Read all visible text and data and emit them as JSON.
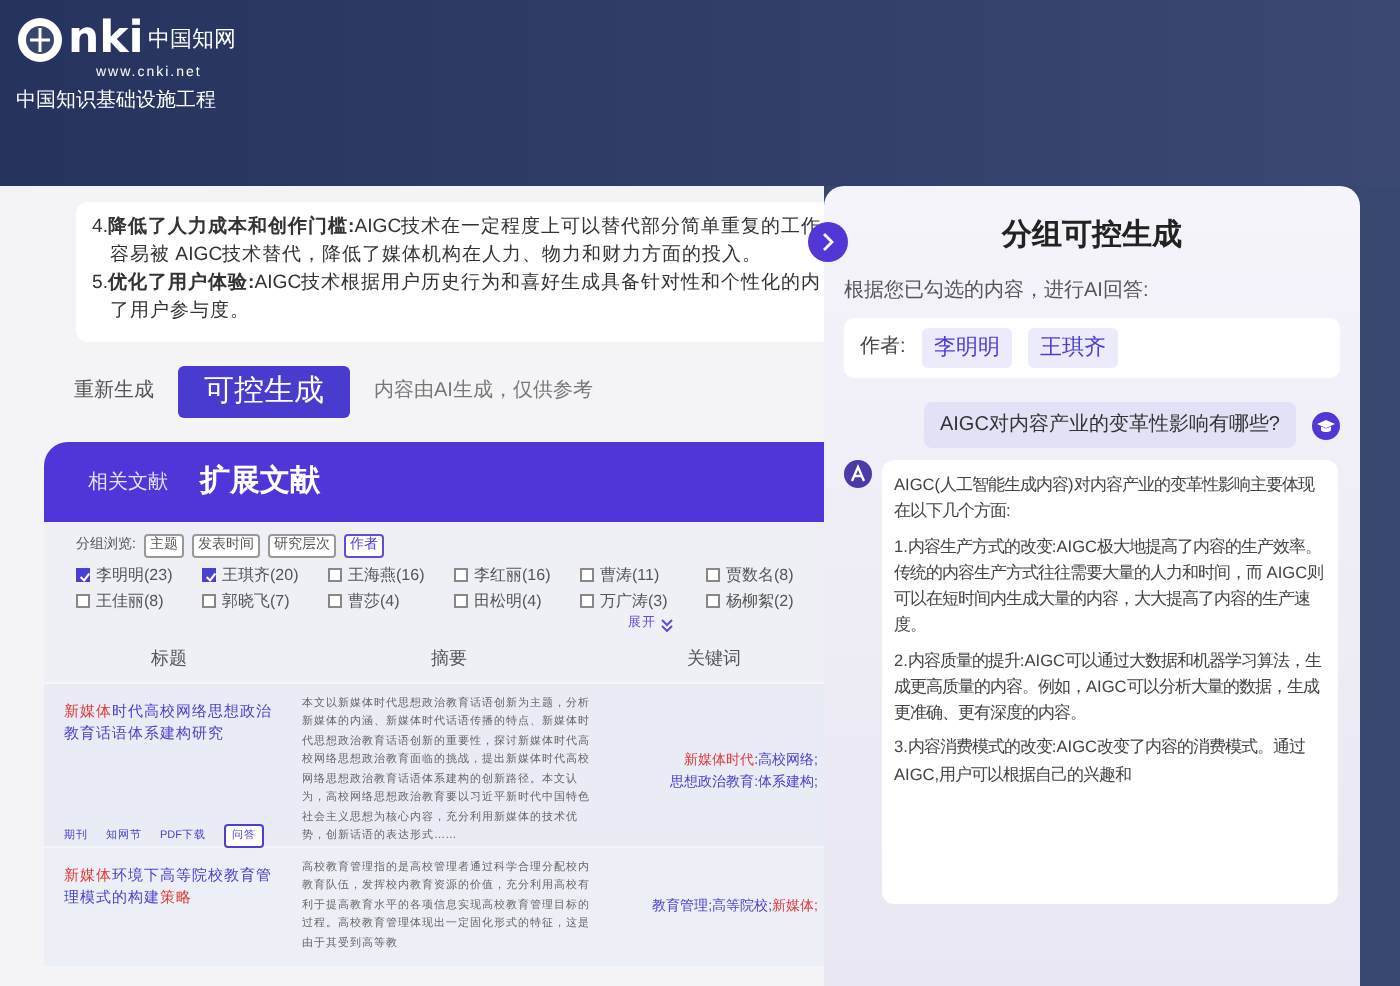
{
  "header": {
    "logo_mark": "nki",
    "logo_name": "中国知网",
    "url": "www.cnki.net",
    "tagline": "中国知识基础设施工程"
  },
  "answer_preview": {
    "lines": [
      "4.**降低了人力成本和创作门槛:**AIGC技术在一定程度上可以替代部分简单重复的工作",
      "容易被 AIGC技术替代，降低了媒体机构在人力、物力和财力方面的投入。",
      "5.**优化了用户体验:**AIGC技术根据用户历史行为和喜好生成具备针对性和个性化的内",
      "了用户参与度。"
    ]
  },
  "actions": {
    "regenerate": "重新生成",
    "controlled": "可控生成",
    "disclaimer": "内容由AI生成，仅供参考"
  },
  "literature": {
    "tabs": [
      {
        "label": "相关文献",
        "selected": false
      },
      {
        "label": "扩展文献",
        "selected": true
      }
    ],
    "group_label": "分组浏览:",
    "groups": [
      {
        "label": "主题",
        "selected": false
      },
      {
        "label": "发表时间",
        "selected": false
      },
      {
        "label": "研究层次",
        "selected": false
      },
      {
        "label": "作者",
        "selected": true
      }
    ],
    "authors": [
      {
        "name": "李明明(23)",
        "checked": true
      },
      {
        "name": "王琪齐(20)",
        "checked": true
      },
      {
        "name": "王海燕(16)",
        "checked": false
      },
      {
        "name": "李红丽(16)",
        "checked": false
      },
      {
        "name": "曹涛(11)",
        "checked": false
      },
      {
        "name": "贾数名(8)",
        "checked": false
      },
      {
        "name": "王佳丽(8)",
        "checked": false
      },
      {
        "name": "郭晓飞(7)",
        "checked": false
      },
      {
        "name": "曹莎(4)",
        "checked": false
      },
      {
        "name": "田松明(4)",
        "checked": false
      },
      {
        "name": "万广涛(3)",
        "checked": false
      },
      {
        "name": "杨柳絮(2)",
        "checked": false
      }
    ],
    "expand": "展开",
    "columns": [
      "标题",
      "摘要",
      "关键词"
    ],
    "rows": [
      {
        "title": [
          {
            "text": "新媒体",
            "highlight": true
          },
          {
            "text": "时代高校网络思想政治教育话语体系建构研究",
            "highlight": false
          }
        ],
        "links": [
          "期刊",
          "知网节",
          "PDF下载"
        ],
        "qa_button": "问答",
        "abstract": "本文以新媒体时代思想政治教育话语创新为主题，分析新媒体的内涵、新媒体时代话语传播的特点、新媒体时代思想政治教育话语创新的重要性，探讨新媒体时代高校网络思想政治教育面临的挑战，提出新媒体时代高校网络思想政治教育话语体系建构的创新路径。本文认为，高校网络思想政治教育要以习近平新时代中国特色社会主义思想为核心内容，充分利用新媒体的技术优势，创新话语的表达形式……",
        "keywords": [
          [
            {
              "text": "新媒体时代",
              "highlight": true
            },
            {
              "text": ":高校网络;",
              "highlight": false
            }
          ],
          [
            {
              "text": "思想政治教育:体系建构;",
              "highlight": false
            }
          ]
        ]
      },
      {
        "title": [
          {
            "text": "新媒体",
            "highlight": true
          },
          {
            "text": "环境下高等院校教育管理模式的构建",
            "highlight": false
          },
          {
            "text": "策略",
            "highlight": true
          }
        ],
        "abstract": "高校教育管理指的是高校管理者通过科学合理分配校内教育队伍，发挥校内教育资源的价值，充分利用高校有利于提高教育水平的各项信息实现高校教育管理目标的过程。高校教育管理体现出一定固化形式的特征，这是由于其受到高等教",
        "keywords": [
          [
            {
              "text": "教育管理;高等院校;",
              "highlight": false
            },
            {
              "text": "新媒体;",
              "highlight": true
            }
          ]
        ]
      }
    ]
  },
  "panel": {
    "title": "分组可控生成",
    "intro": "根据您已勾选的内容，进行AI回答:",
    "filter_label": "作者:",
    "chips": [
      "李明明",
      "王琪齐"
    ],
    "question": "AIGC对内容产业的变革性影响有哪些?",
    "answer": [
      "AIGC(人工智能生成内容)对内容产业的变革性影响主要体现在以下几个方面:",
      "1.内容生产方式的改变:AIGC极大地提高了内容的生产效率。传统的内容生产方式往往需要大量的人力和时间，而 AIGC则可以在短时间内生成大量的内容，大大提高了内容的生产速度。",
      "2.内容质量的提升:AIGC可以通过大数据和机器学习算法，生成更高质量的内容。例如，AIGC可以分析大量的数据，生成更准确、更有深度的内容。",
      "3.内容消费模式的改变:AIGC改变了内容的消费模式。通过AIGC,用户可以根据自己的兴趣和"
    ]
  }
}
